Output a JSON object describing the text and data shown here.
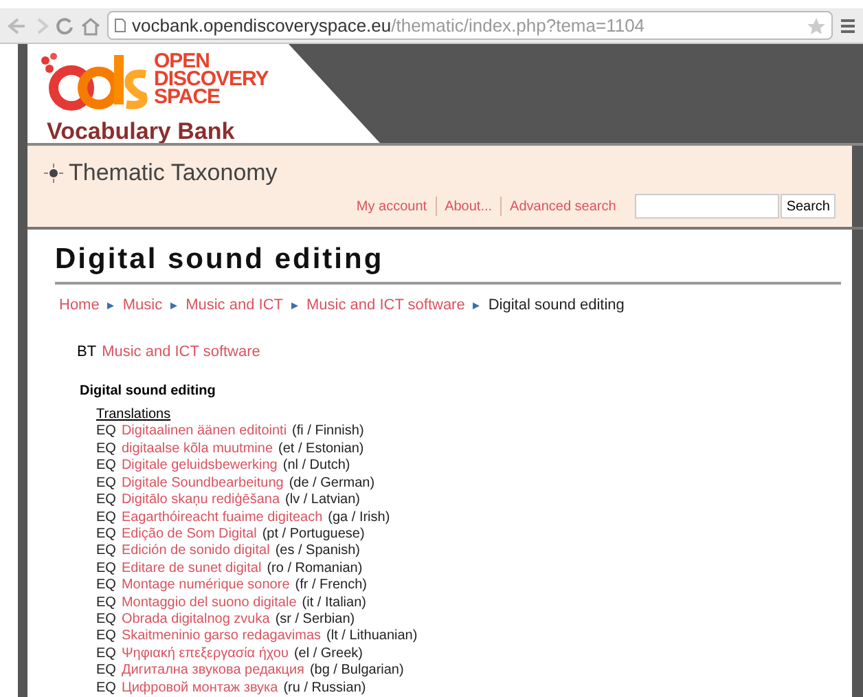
{
  "browser": {
    "url_host": "vocbank.opendiscoveryspace.eu",
    "url_path": "/thematic/index.php?tema=1104"
  },
  "header": {
    "logo_lines": [
      "OPEN",
      "DISCOVERY",
      "SPACE"
    ],
    "subtitle": "Vocabulary Bank"
  },
  "band": {
    "title": "Thematic Taxonomy",
    "links": [
      "My account",
      "About...",
      "Advanced search"
    ],
    "search_button": "Search"
  },
  "page_title": "Digital sound editing",
  "breadcrumb": [
    {
      "label": "Home",
      "link": true
    },
    {
      "label": "Music",
      "link": true
    },
    {
      "label": "Music and ICT",
      "link": true
    },
    {
      "label": "Music and ICT software",
      "link": true
    },
    {
      "label": "Digital sound editing",
      "link": false
    }
  ],
  "broader": {
    "tag": "BT",
    "term": "Music and ICT software"
  },
  "term": "Digital sound editing",
  "translations_heading": "Translations",
  "translations": [
    {
      "tag": "EQ",
      "term": "Digitaalinen äänen editointi",
      "lang": "(fi / Finnish)"
    },
    {
      "tag": "EQ",
      "term": "digitaalse kõla muutmine",
      "lang": "(et / Estonian)"
    },
    {
      "tag": "EQ",
      "term": "Digitale geluidsbewerking",
      "lang": "(nl / Dutch)"
    },
    {
      "tag": "EQ",
      "term": "Digitale Soundbearbeitung",
      "lang": "(de / German)"
    },
    {
      "tag": "EQ",
      "term": "Digitālo skaņu rediģēšana",
      "lang": "(lv / Latvian)"
    },
    {
      "tag": "EQ",
      "term": "Eagarthóireacht fuaime digiteach",
      "lang": "(ga / Irish)"
    },
    {
      "tag": "EQ",
      "term": "Edição de Som Digital",
      "lang": "(pt / Portuguese)"
    },
    {
      "tag": "EQ",
      "term": "Edición de sonido digital",
      "lang": "(es / Spanish)"
    },
    {
      "tag": "EQ",
      "term": "Editare de sunet digital",
      "lang": "(ro / Romanian)"
    },
    {
      "tag": "EQ",
      "term": "Montage numérique sonore",
      "lang": "(fr / French)"
    },
    {
      "tag": "EQ",
      "term": "Montaggio del suono digitale",
      "lang": "(it / Italian)"
    },
    {
      "tag": "EQ",
      "term": "Obrada digitalnog zvuka",
      "lang": "(sr / Serbian)"
    },
    {
      "tag": "EQ",
      "term": "Skaitmeninio garso redagavimas",
      "lang": "(lt / Lithuanian)"
    },
    {
      "tag": "EQ",
      "term": "Ψηφιακή επεξεργασία ήχου",
      "lang": "(el / Greek)"
    },
    {
      "tag": "EQ",
      "term": "Дигитална звукова редакция",
      "lang": "(bg / Bulgarian)"
    },
    {
      "tag": "EQ",
      "term": "Цифровой монтаж звука",
      "lang": "(ru / Russian)"
    }
  ]
}
